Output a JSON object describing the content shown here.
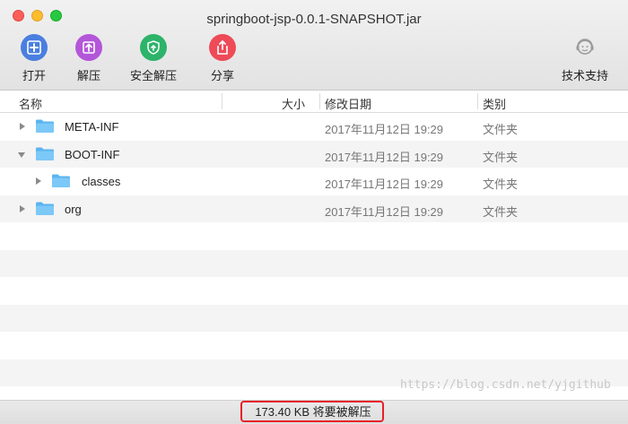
{
  "window": {
    "title": "springboot-jsp-0.0.1-SNAPSHOT.jar"
  },
  "toolbar": {
    "open_label": "打开",
    "extract_label": "解压",
    "safe_extract_label": "安全解压",
    "share_label": "分享",
    "support_label": "技术支持"
  },
  "columns": {
    "name": "名称",
    "size": "大小",
    "modified": "修改日期",
    "kind": "类别"
  },
  "rows": [
    {
      "name": "META-INF",
      "date": "2017年11月12日 19:29",
      "kind": "文件夹",
      "expanded": false,
      "level": 0
    },
    {
      "name": "BOOT-INF",
      "date": "2017年11月12日 19:29",
      "kind": "文件夹",
      "expanded": true,
      "level": 0
    },
    {
      "name": "classes",
      "date": "2017年11月12日 19:29",
      "kind": "文件夹",
      "expanded": false,
      "level": 1
    },
    {
      "name": "org",
      "date": "2017年11月12日 19:29",
      "kind": "文件夹",
      "expanded": false,
      "level": 0
    }
  ],
  "status": {
    "text": "173.40 KB 将要被解压",
    "watermark": "https://blog.csdn.net/yjgithub"
  },
  "colors": {
    "accent_box": "#e8202a",
    "folder": "#5ab4f0",
    "open_icon": "#4a7fe0",
    "extract_icon": "#b356d9",
    "safe_icon": "#2db36a",
    "share_icon": "#ee4a57"
  }
}
